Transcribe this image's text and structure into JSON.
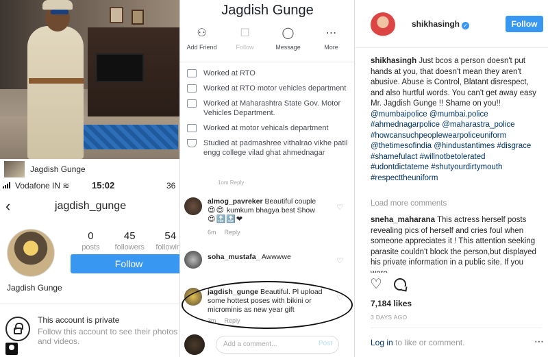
{
  "left_panel": {
    "fb_name_caption": "Jagdish Gunge",
    "status": {
      "carrier": "Vodafone IN",
      "time": "15:02",
      "battery": "36"
    },
    "profile": {
      "username": "jagdish_gunge",
      "stats": [
        {
          "num": "0",
          "label": "posts"
        },
        {
          "num": "45",
          "label": "followers"
        },
        {
          "num": "54",
          "label": "following"
        }
      ],
      "follow_label": "Follow",
      "display_name": "Jagdish Gunge",
      "private_title": "This account is private",
      "private_sub": "Follow this account to see their photos and videos."
    }
  },
  "middle_panel": {
    "title": "Jagdish Gunge",
    "actions": [
      {
        "label": "Add Friend",
        "icon": "add-friend-icon"
      },
      {
        "label": "Follow",
        "icon": "follow-icon"
      },
      {
        "label": "Message",
        "icon": "messenger-icon"
      },
      {
        "label": "More",
        "icon": "more-icon"
      }
    ],
    "info": [
      "Worked at RTO",
      "Worked at RTO motor vehicles department",
      "Worked at Maharashtra State Gov. Motor Vehicles Department.",
      "Worked at motor vehicals department",
      "Studied at padmashree vithalrao vikhe patil engg college vilad ghat ahmednagar"
    ],
    "cut_meta": "1om   Reply",
    "comments": [
      {
        "user": "almog_pavreker",
        "text": "Beautiful couple",
        "text2": "kumkum bhagya best Show",
        "time": "6m",
        "reply": "Reply"
      },
      {
        "user": "soha_mustafa_",
        "text": "Awwwwe",
        "time": "",
        "reply": ""
      },
      {
        "user": "jagdish_gunge",
        "text": "Beautiful. Pl upload some hottest poses with bikini or microminis as new year gift",
        "time": "3m",
        "reply": "Reply"
      }
    ],
    "add_comment": {
      "placeholder": "Add a comment...",
      "post": "Post"
    }
  },
  "right_panel": {
    "username": "shikhasingh",
    "follow_label": "Follow",
    "caption_user": "shikhasingh",
    "caption_text": "Just bcos a person doesn't put hands at you, that doesn't mean they aren't abusive. Abuse is Control, Blatant disrespect, and also hurtful words. You can't get away easy Mr. Jagdish Gunge !! Shame on you!!",
    "caption_tags": "@mumbaipolice @mumbai.police #ahmednagarpolice @maharastra_police #howcansuchpeoplewearpoliceuniform @thetimesofindia @hindustantimes #disgrace #shamefulact #willnotbetolerated #udontdictateme #shutyourdirtymouth #respecttheuniform",
    "load_more": "Load more comments",
    "comment2_user": "sneha_maharana",
    "comment2_text": "This actress herself posts revealing pics of herself and cries foul when someone appreciates it ! This attention seeking parasite couldn't block the person,but displayed his private information in a public site. If you were",
    "likes": "7,184 likes",
    "ago": "3 DAYS AGO",
    "login_link": "Log in",
    "login_text": "to like or comment."
  },
  "colors": {
    "ig_blue": "#3897f0",
    "link_navy": "#003569",
    "muted": "#999999"
  }
}
